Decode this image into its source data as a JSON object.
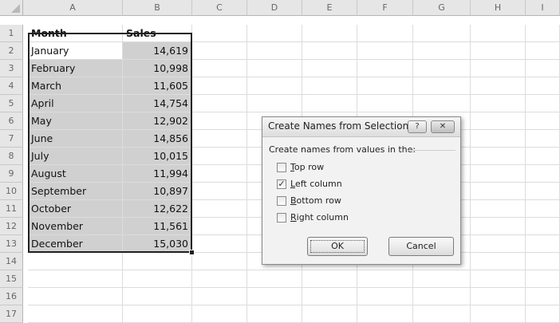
{
  "sheet": {
    "columns": [
      "A",
      "B",
      "C",
      "D",
      "E",
      "F",
      "G",
      "H",
      "I"
    ],
    "rows": [
      "1",
      "2",
      "3",
      "4",
      "5",
      "6",
      "7",
      "8",
      "9",
      "10",
      "11",
      "12",
      "13",
      "14",
      "15",
      "16",
      "17"
    ],
    "header": {
      "month": "Month",
      "sales": "Sales"
    },
    "data": [
      {
        "month": "January",
        "sales": "14,619"
      },
      {
        "month": "February",
        "sales": "10,998"
      },
      {
        "month": "March",
        "sales": "11,605"
      },
      {
        "month": "April",
        "sales": "14,754"
      },
      {
        "month": "May",
        "sales": "12,902"
      },
      {
        "month": "June",
        "sales": "14,856"
      },
      {
        "month": "July",
        "sales": "10,015"
      },
      {
        "month": "August",
        "sales": "11,994"
      },
      {
        "month": "September",
        "sales": "10,897"
      },
      {
        "month": "October",
        "sales": "12,622"
      },
      {
        "month": "November",
        "sales": "11,561"
      },
      {
        "month": "December",
        "sales": "15,030"
      }
    ]
  },
  "dialog": {
    "title": "Create Names from Selection",
    "help_button": "?",
    "close_button": "✕",
    "section_label": "Create names from values in the:",
    "options": [
      {
        "mnemonic": "T",
        "rest": "op row",
        "checked": false
      },
      {
        "mnemonic": "L",
        "rest": "eft column",
        "checked": true
      },
      {
        "mnemonic": "B",
        "rest": "ottom row",
        "checked": false
      },
      {
        "mnemonic": "R",
        "rest": "ight column",
        "checked": false
      }
    ],
    "ok_label": "OK",
    "cancel_label": "Cancel"
  },
  "colors": {
    "selection_fill": "#d0d0d0",
    "header_fill": "#e6e6e6"
  }
}
